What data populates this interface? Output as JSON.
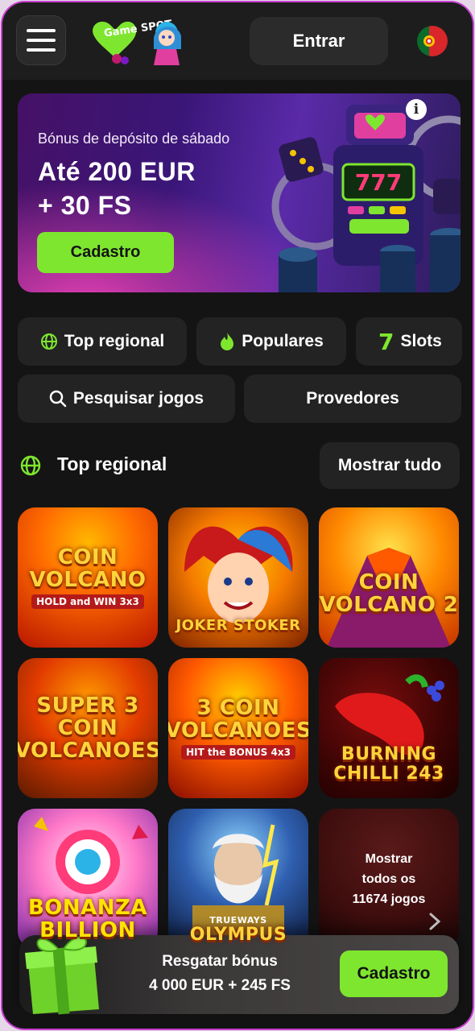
{
  "header": {
    "login_label": "Entrar",
    "logo_text": "Game SPOT",
    "language": "Portugal"
  },
  "banner": {
    "subtitle": "Bónus de depósito de sábado",
    "title_line1": "Até 200 EUR",
    "title_line2": "+ 30 FS",
    "cta_label": "Cadastro",
    "info_symbol": "i"
  },
  "categories": {
    "top_regional": "Top regional",
    "popular": "Populares",
    "slots": "Slots",
    "slots_glyph": "7",
    "search": "Pesquisar jogos",
    "providers": "Provedores"
  },
  "section": {
    "title": "Top regional",
    "show_all_label": "Mostrar tudo"
  },
  "games": [
    {
      "line1": "COIN",
      "line2": "VOLCANO",
      "tag": "HOLD and WIN 3x3"
    },
    {
      "line1": "JOKER",
      "line2": "STOKER",
      "tag": ""
    },
    {
      "line1": "COIN",
      "line2": "VOLCANO 2",
      "tag": ""
    },
    {
      "line1": "SUPER 3 COIN",
      "line2": "VOLCANOES",
      "tag": ""
    },
    {
      "line1": "3 COIN",
      "line2": "VOLCANOES",
      "tag": "HIT the BONUS 4x3"
    },
    {
      "line1": "BURNING",
      "line2": "CHILLI 243",
      "tag": ""
    },
    {
      "line1": "BONANZA",
      "line2": "BILLION",
      "tag": ""
    },
    {
      "line1": "TRUEWAYS",
      "line2": "OLYMPUS",
      "tag": ""
    }
  ],
  "show_more": {
    "line1": "Mostrar",
    "line2": "todos os",
    "line3": "11674 jogos"
  },
  "bonus_bar": {
    "line1": "Resgatar bónus",
    "line2": "4 000 EUR + 245 FS",
    "cta_label": "Cadastro"
  },
  "colors": {
    "accent_green": "#7ee62f",
    "background": "#141414",
    "surface": "#232323",
    "frame_border": "#c93fd0"
  }
}
